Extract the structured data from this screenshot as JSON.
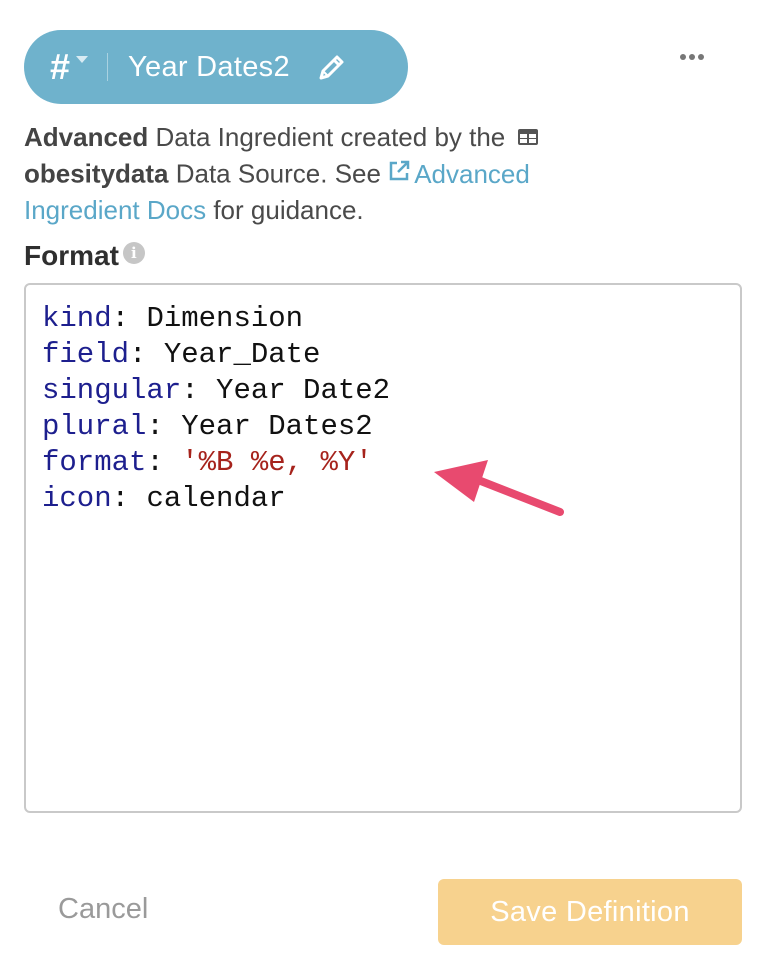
{
  "header": {
    "type_symbol": "#",
    "title": "Year Dates2"
  },
  "description": {
    "bold_prefix": "Advanced",
    "text1": " Data Ingredient created by the ",
    "source_name": "obesitydata",
    "text2": " Data Source. See ",
    "link_text": "Advanced Ingredient Docs",
    "text3": " for guidance."
  },
  "format": {
    "label": "Format",
    "lines": [
      {
        "key": "kind",
        "value": "Dimension",
        "is_string": false
      },
      {
        "key": "field",
        "value": "Year_Date",
        "is_string": false
      },
      {
        "key": "singular",
        "value": "Year Date2",
        "is_string": false
      },
      {
        "key": "plural",
        "value": "Year Dates2",
        "is_string": false
      },
      {
        "key": "format",
        "value": "'%B %e, %Y'",
        "is_string": true
      },
      {
        "key": "icon",
        "value": "calendar",
        "is_string": false
      }
    ]
  },
  "footer": {
    "cancel_label": "Cancel",
    "save_label": "Save Definition"
  },
  "colors": {
    "pill": "#6fb2cc",
    "link": "#5aa7c8",
    "yaml_key": "#1d1f8e",
    "yaml_string": "#a6231c",
    "save_button": "#f7d28e",
    "annotation_arrow": "#e84a6f"
  },
  "icons": [
    "hash-type-icon",
    "pencil-icon",
    "more-dots-icon",
    "table-icon",
    "external-link-icon",
    "info-icon",
    "annotation-arrow-icon"
  ]
}
